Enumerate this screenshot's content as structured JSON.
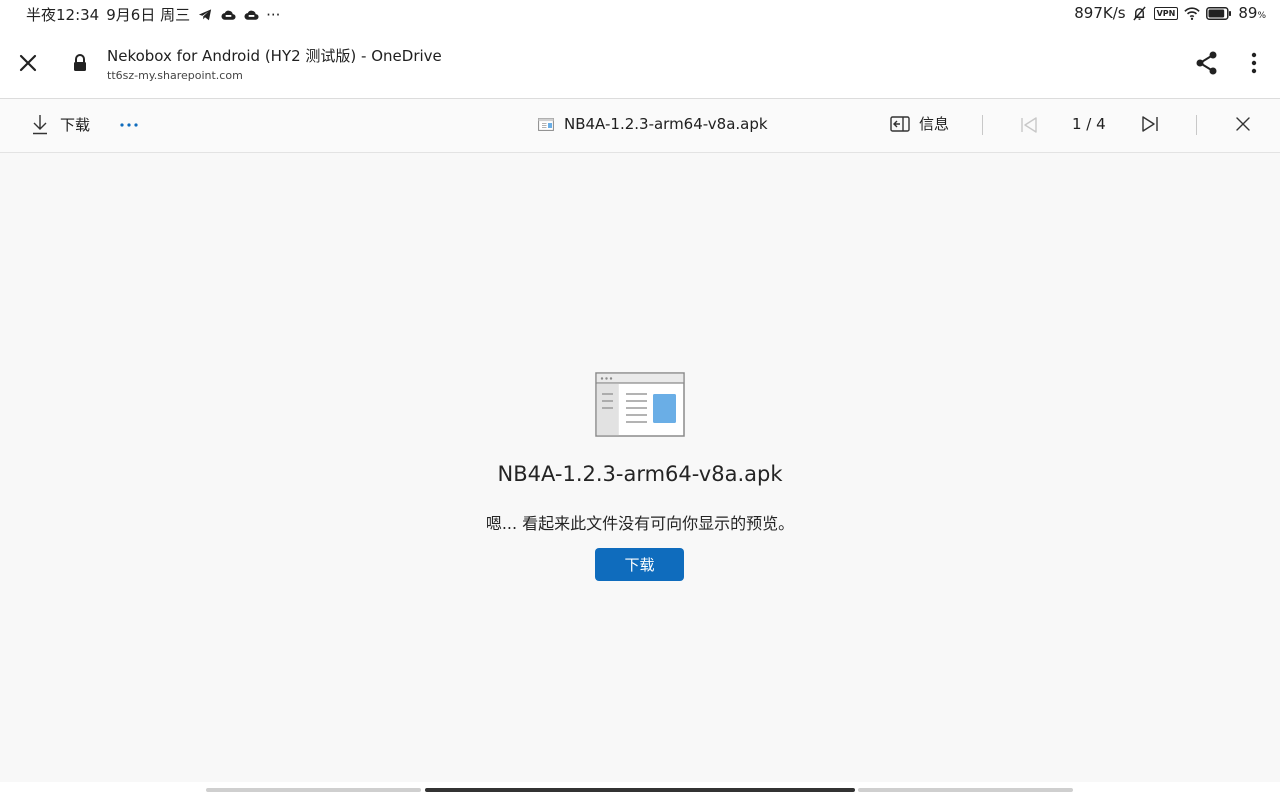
{
  "status_bar": {
    "time": "半夜12:34",
    "date": "9月6日 周三",
    "more_indicator": "···",
    "speed": "897K/s",
    "vpn_label": "VPN",
    "battery": "89",
    "battery_unit": "%",
    "battery_level": 0.89,
    "left_icons": [
      "telegram-icon",
      "cloud-icon",
      "cloud-icon"
    ],
    "right_icons": [
      "bell-off-icon",
      "vpn-icon",
      "wifi-icon",
      "battery-icon"
    ]
  },
  "browser": {
    "title": "Nekobox for Android (HY2 测试版) - OneDrive",
    "url": "tt6sz-my.sharepoint.com"
  },
  "toolbar": {
    "download_label": "下载",
    "file_name": "NB4A-1.2.3-arm64-v8a.apk",
    "info_label": "信息",
    "pager": "1 / 4"
  },
  "preview": {
    "file_name": "NB4A-1.2.3-arm64-v8a.apk",
    "message": "嗯... 看起来此文件没有可向你显示的预览。",
    "download_button": "下载"
  },
  "colors": {
    "accent": "#0f6cbd",
    "illustration_blue": "#6aaee6",
    "content_bg": "#f8f8f8"
  }
}
